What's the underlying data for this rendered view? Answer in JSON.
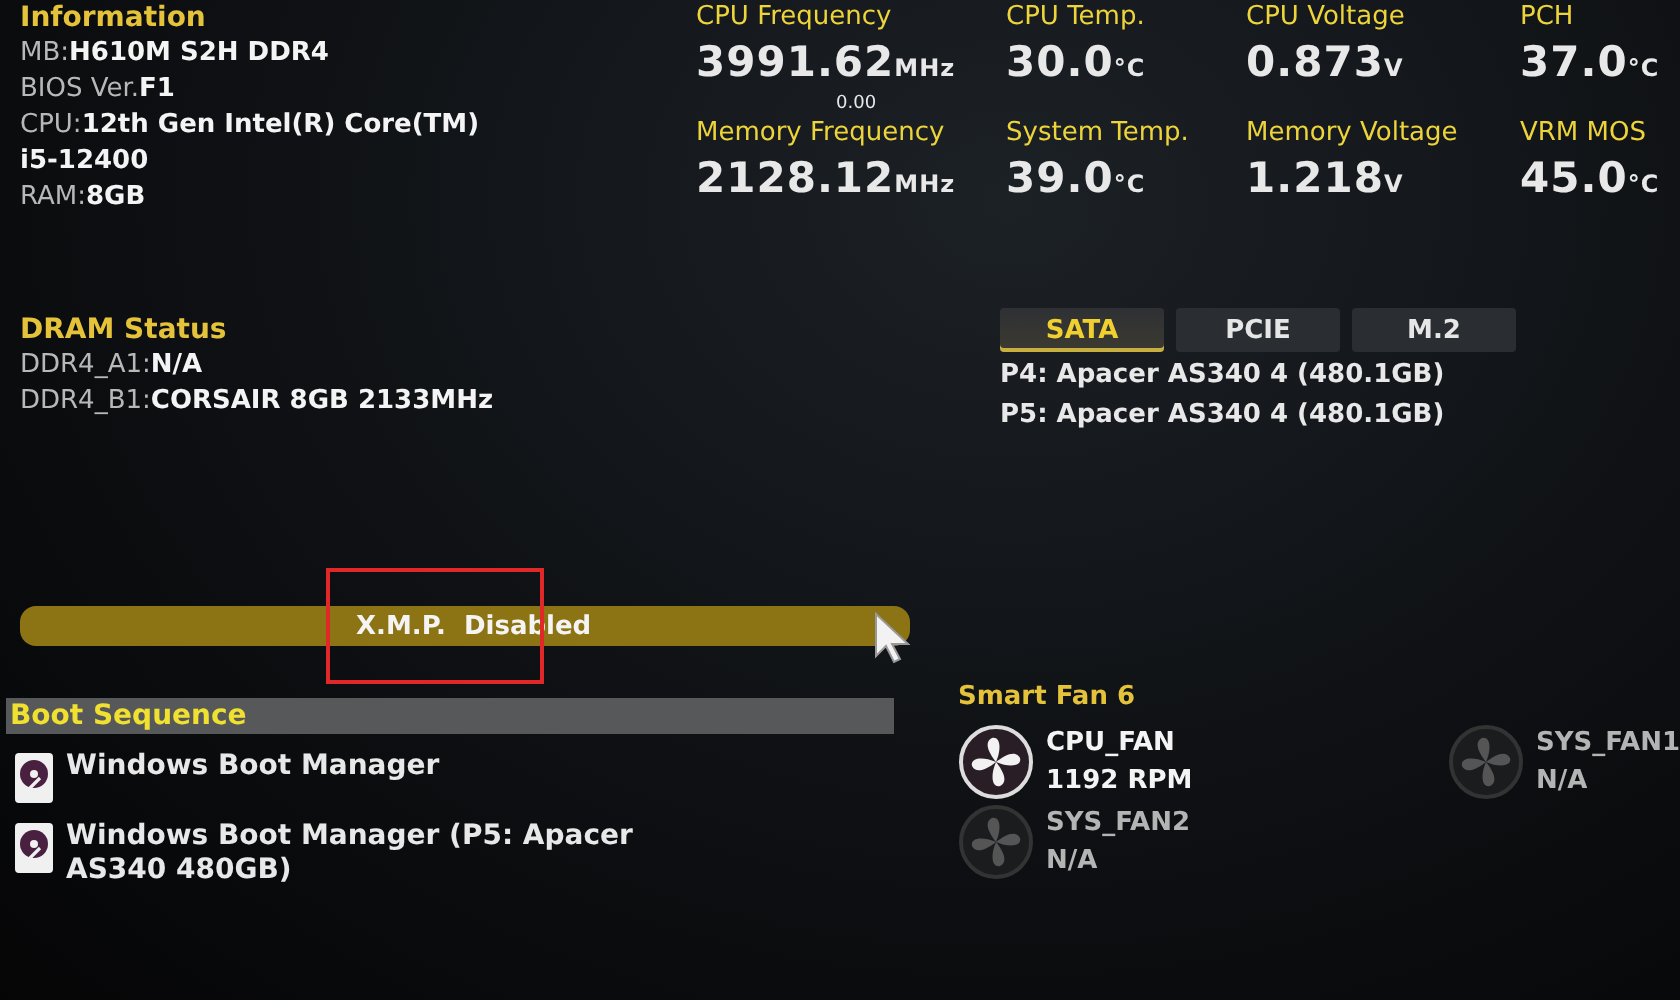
{
  "information": {
    "title": "Information",
    "lines": [
      {
        "label": "MB:",
        "value": "H610M S2H DDR4"
      },
      {
        "label": "BIOS Ver.",
        "value": "F1"
      },
      {
        "label": "CPU:",
        "value": "12th Gen Intel(R) Core(TM)"
      },
      {
        "value": "i5-12400"
      },
      {
        "label": "RAM:",
        "value": "8GB"
      }
    ]
  },
  "readings": [
    {
      "label": "CPU Frequency",
      "value": "3991.62",
      "unit": "MHz",
      "sub": "0.00"
    },
    {
      "label": "CPU Temp.",
      "value": "30.0",
      "unit": "°C"
    },
    {
      "label": "CPU Voltage",
      "value": "0.873",
      "unit": "V"
    },
    {
      "label": "PCH",
      "value": "37.0",
      "unit": "°C"
    },
    {
      "label": "Memory Frequency",
      "value": "2128.12",
      "unit": "MHz"
    },
    {
      "label": "System Temp.",
      "value": "39.0",
      "unit": "°C"
    },
    {
      "label": "Memory Voltage",
      "value": "1.218",
      "unit": "V"
    },
    {
      "label": "VRM MOS",
      "value": "45.0",
      "unit": "°C"
    }
  ],
  "dram_status": {
    "title": "DRAM Status",
    "lines": [
      {
        "label": "DDR4_A1:",
        "value": "N/A"
      },
      {
        "label": "DDR4_B1:",
        "value": "CORSAIR 8GB 2133MHz"
      }
    ]
  },
  "storage": {
    "tabs": [
      {
        "label": "SATA",
        "selected": true
      },
      {
        "label": "PCIE",
        "selected": false
      },
      {
        "label": "M.2",
        "selected": false
      }
    ],
    "devices": [
      "P4: Apacer AS340 4 (480.1GB)",
      "P5: Apacer AS340 4 (480.1GB)"
    ]
  },
  "xmp": {
    "label": "X.M.P.  Disabled"
  },
  "boot_sequence": {
    "title": "Boot Sequence",
    "items": [
      "Windows Boot Manager",
      "Windows Boot Manager (P5: Apacer AS340 480GB)"
    ]
  },
  "smart_fan": {
    "title": "Smart Fan 6",
    "fans": [
      {
        "name": "CPU_FAN",
        "reading": "1192 RPM",
        "active": true
      },
      {
        "name": "SYS_FAN1",
        "reading": "N/A",
        "active": false
      },
      {
        "name": "SYS_FAN2",
        "reading": "N/A",
        "active": false
      }
    ]
  }
}
